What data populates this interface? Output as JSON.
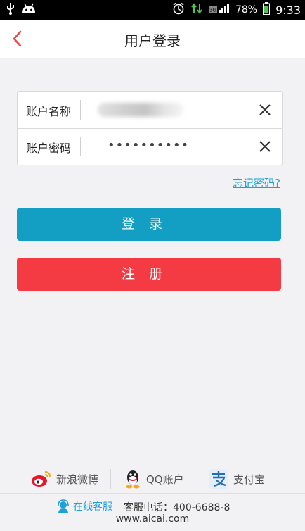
{
  "status_bar": {
    "battery": "78%",
    "time": "9:33",
    "network": "3G"
  },
  "header": {
    "title": "用户登录",
    "back_icon": "chevron-left-icon"
  },
  "form": {
    "account_label": "账户名称",
    "password_label": "账户密码",
    "password_mask": "••••••••••"
  },
  "forgot_password": "忘记密码?",
  "buttons": {
    "login": "登录",
    "register": "注册"
  },
  "social": {
    "weibo": "新浪微博",
    "qq": "QQ账户",
    "alipay": "支付宝"
  },
  "footer": {
    "online_service": "在线客服",
    "phone_label": "客服电话：400-6688-8",
    "website": "www.aicai.com"
  },
  "colors": {
    "accent_blue": "#139fc4",
    "accent_red": "#f43b43",
    "link_blue": "#1ea1d6"
  }
}
